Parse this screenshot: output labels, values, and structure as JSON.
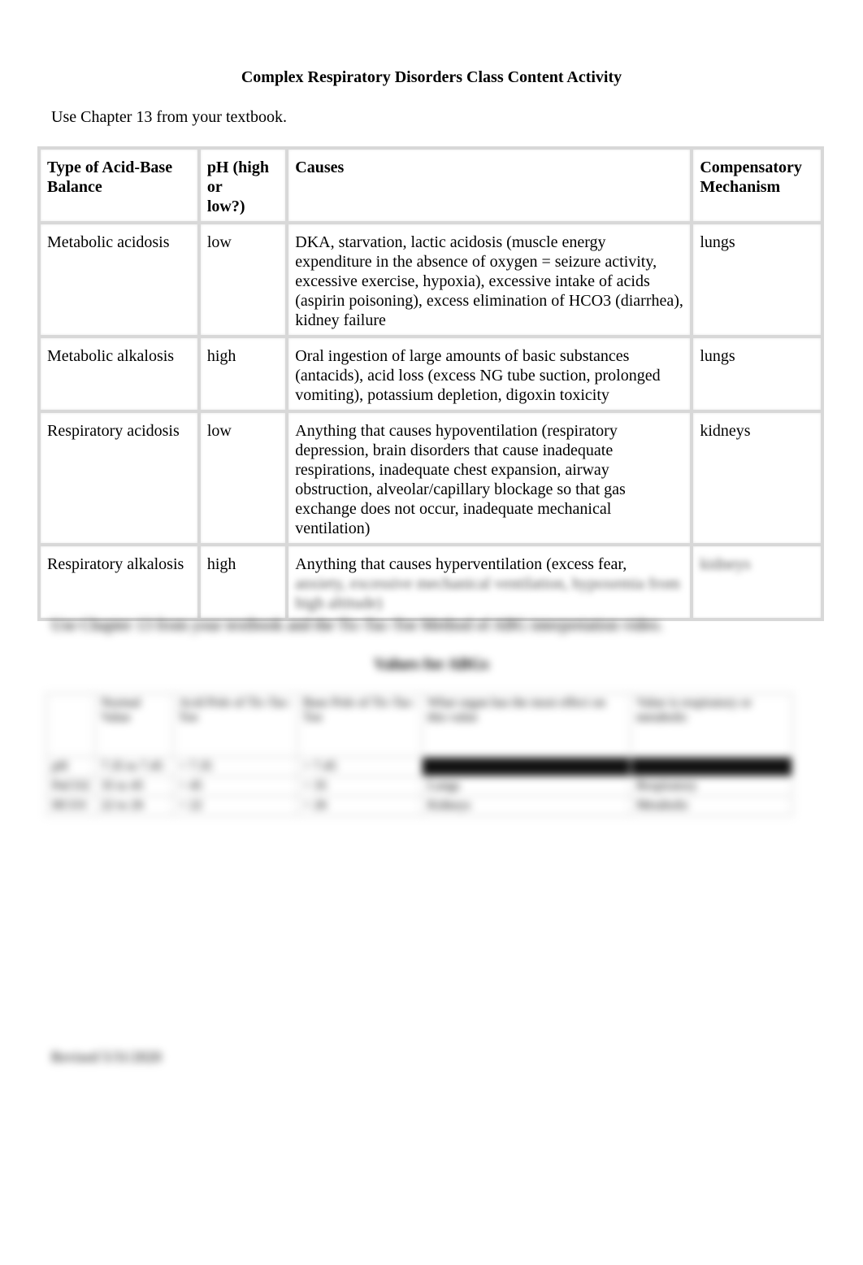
{
  "document": {
    "title": "Complex Respiratory Disorders Class Content Activity",
    "intro": "Use Chapter 13 from your textbook."
  },
  "table": {
    "headers": [
      "Type of Acid-Base Balance",
      "pH (high or low?)",
      "Causes",
      "Compensatory Mechanism"
    ],
    "header_parts": {
      "type_line1": "Type of Acid-Base",
      "type_line2": "Balance",
      "ph_line1": "pH (high or",
      "ph_line2": "low?)",
      "causes": "Causes",
      "comp_line1": "Compensatory",
      "comp_line2": "Mechanism"
    },
    "rows": [
      {
        "type": "Metabolic acidosis",
        "ph": "low",
        "causes": "DKA, starvation, lactic acidosis (muscle energy expenditure in the absence of oxygen = seizure activity, excessive exercise, hypoxia), excessive intake of acids (aspirin poisoning), excess elimination of HCO3 (diarrhea), kidney failure",
        "mechanism": "lungs"
      },
      {
        "type": "Metabolic alkalosis",
        "ph": "high",
        "causes": "Oral ingestion of large amounts of basic substances (antacids), acid loss (excess NG tube suction, prolonged vomiting), potassium depletion, digoxin toxicity",
        "mechanism": "lungs"
      },
      {
        "type": "Respiratory acidosis",
        "ph": "low",
        "causes": "Anything that causes hypoventilation (respiratory depression, brain disorders that cause inadequate respirations, inadequate chest expansion, airway obstruction, alveolar/capillary blockage so that gas exchange does not occur, inadequate mechanical ventilation)",
        "mechanism": "kidneys"
      },
      {
        "type": "Respiratory alkalosis",
        "ph": "high",
        "causes_visible": "Anything that causes hyperventilation (excess fear,",
        "causes_blurred": "anxiety, excessive mechanical ventilation, hypoxemia from high altitude)",
        "mechanism_blurred": "kidneys"
      }
    ]
  },
  "blurred_section": {
    "intro": "Use Chapter 13 from your textbook and the Tic-Tac-Toe Method of ABG interpretation video.",
    "subtitle": "Values for ABGs",
    "headers": [
      "",
      "Normal Value",
      "Acid Pole of Tic-Tac-Toe",
      "Base Pole of Tic-Tac-Toe",
      "What organ has the most effect on this value",
      "Value is respiratory or metabolic"
    ],
    "rows": [
      [
        "pH",
        "7.35 to 7.45",
        "< 7.35",
        "> 7.45",
        "",
        ""
      ],
      [
        "PaCO2",
        "35 to 45",
        "> 45",
        "< 35",
        "Lungs",
        "Respiratory"
      ],
      [
        "HCO3",
        "22 to 26",
        "< 22",
        "> 26",
        "Kidneys",
        "Metabolic"
      ]
    ],
    "footer": "Revised 5/31/2020"
  }
}
